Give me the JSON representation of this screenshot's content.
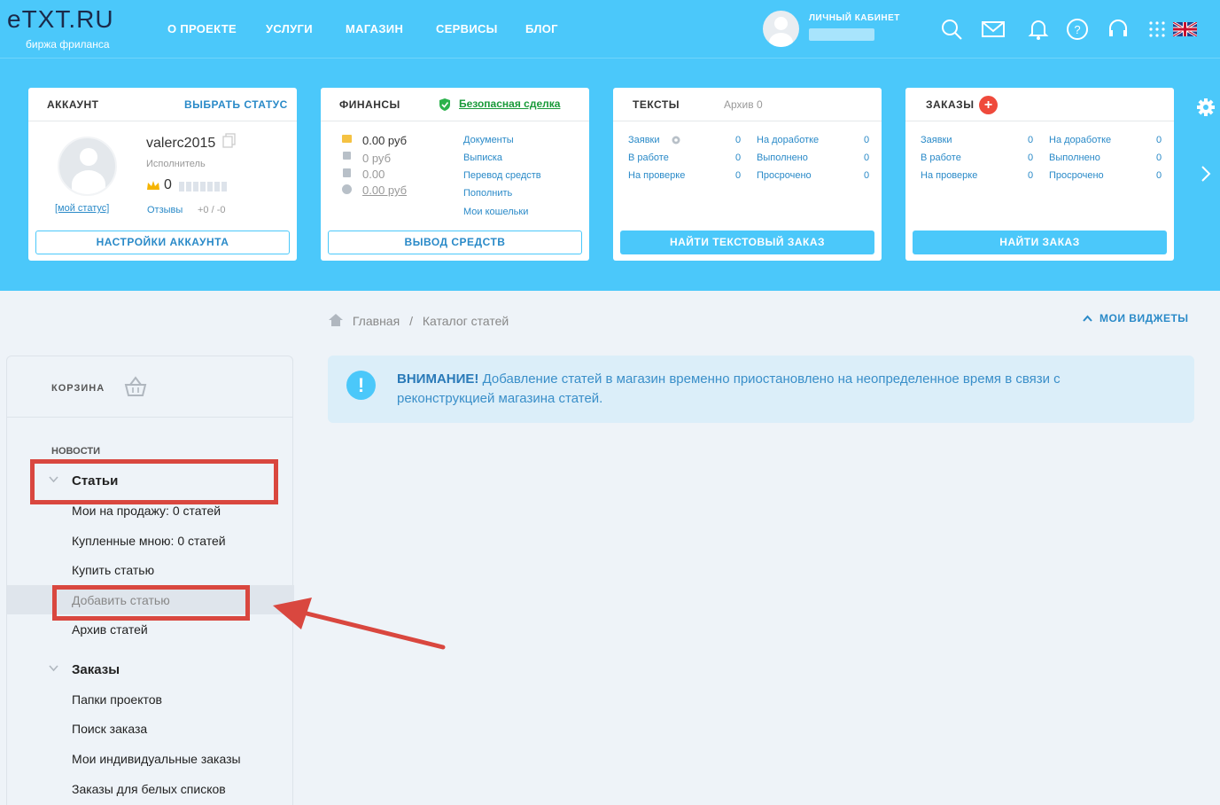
{
  "header": {
    "logo": "eTXT.RU",
    "logo_sub": "биржа фриланса",
    "nav": [
      "О ПРОЕКТЕ",
      "УСЛУГИ",
      "МАГАЗИН",
      "СЕРВИСЫ",
      "БЛОГ"
    ],
    "cabinet_label": "ЛИЧНЫЙ КАБИНЕТ",
    "icons": [
      "search-icon",
      "mail-icon",
      "bell-icon",
      "help-icon",
      "headset-icon",
      "grid-icon",
      "uk-flag-icon"
    ]
  },
  "cards": {
    "account": {
      "title": "АККАУНТ",
      "status_link": "ВЫБРАТЬ СТАТУС",
      "username": "valerc2015",
      "role": "Исполнитель",
      "rating": "0",
      "my_status": "[мой статус]",
      "reviews_label": "Отзывы",
      "reviews_value": "+0 / -0",
      "button": "НАСТРОЙКИ АККАУНТА"
    },
    "finance": {
      "title": "ФИНАНСЫ",
      "safe_deal": "Безопасная сделка",
      "balances": [
        "0.00 руб",
        "0 руб",
        "0.00",
        "0.00 руб"
      ],
      "links": [
        "Документы",
        "Выписка",
        "Перевод средств",
        "Пополнить",
        "Мои кошельки"
      ],
      "button": "ВЫВОД СРЕДСТВ"
    },
    "texts": {
      "title": "ТЕКСТЫ",
      "archive": "Архив 0",
      "left": [
        {
          "label": "Заявки",
          "value": "0"
        },
        {
          "label": "В работе",
          "value": "0"
        },
        {
          "label": "На проверке",
          "value": "0"
        }
      ],
      "right": [
        {
          "label": "На доработке",
          "value": "0"
        },
        {
          "label": "Выполнено",
          "value": "0"
        },
        {
          "label": "Просрочено",
          "value": "0"
        }
      ],
      "button": "НАЙТИ ТЕКСТОВЫЙ ЗАКАЗ"
    },
    "orders": {
      "title": "ЗАКАЗЫ",
      "left": [
        {
          "label": "Заявки",
          "value": "0"
        },
        {
          "label": "В работе",
          "value": "0"
        },
        {
          "label": "На проверке",
          "value": "0"
        }
      ],
      "right": [
        {
          "label": "На доработке",
          "value": "0"
        },
        {
          "label": "Выполнено",
          "value": "0"
        },
        {
          "label": "Просрочено",
          "value": "0"
        }
      ],
      "button": "НАЙТИ ЗАКАЗ"
    }
  },
  "breadcrumb": {
    "home": "Главная",
    "sep": "/",
    "current": "Каталог статей"
  },
  "widgets_label": "МОИ ВИДЖЕТЫ",
  "alert": {
    "bold": "ВНИМАНИЕ!",
    "text": "Добавление статей в магазин временно приостановлено на неопределенное время в связи с реконструкцией магазина статей."
  },
  "sidebar": {
    "basket": "КОРЗИНА",
    "news": "НОВОСТИ",
    "articles_title": "Статьи",
    "articles": [
      "Мои на продажу: 0 статей",
      "Купленные мною: 0 статей",
      "Купить статью",
      "Добавить статью",
      "Архив статей"
    ],
    "orders_title": "Заказы",
    "orders": [
      "Папки проектов",
      "Поиск заказа",
      "Мои индивидуальные заказы",
      "Заказы для белых списков"
    ]
  },
  "colors": {
    "header": "#4bc8fa",
    "accent": "#2a8ac8",
    "highlight": "#d9473f",
    "link_green": "#1a9a3a"
  }
}
